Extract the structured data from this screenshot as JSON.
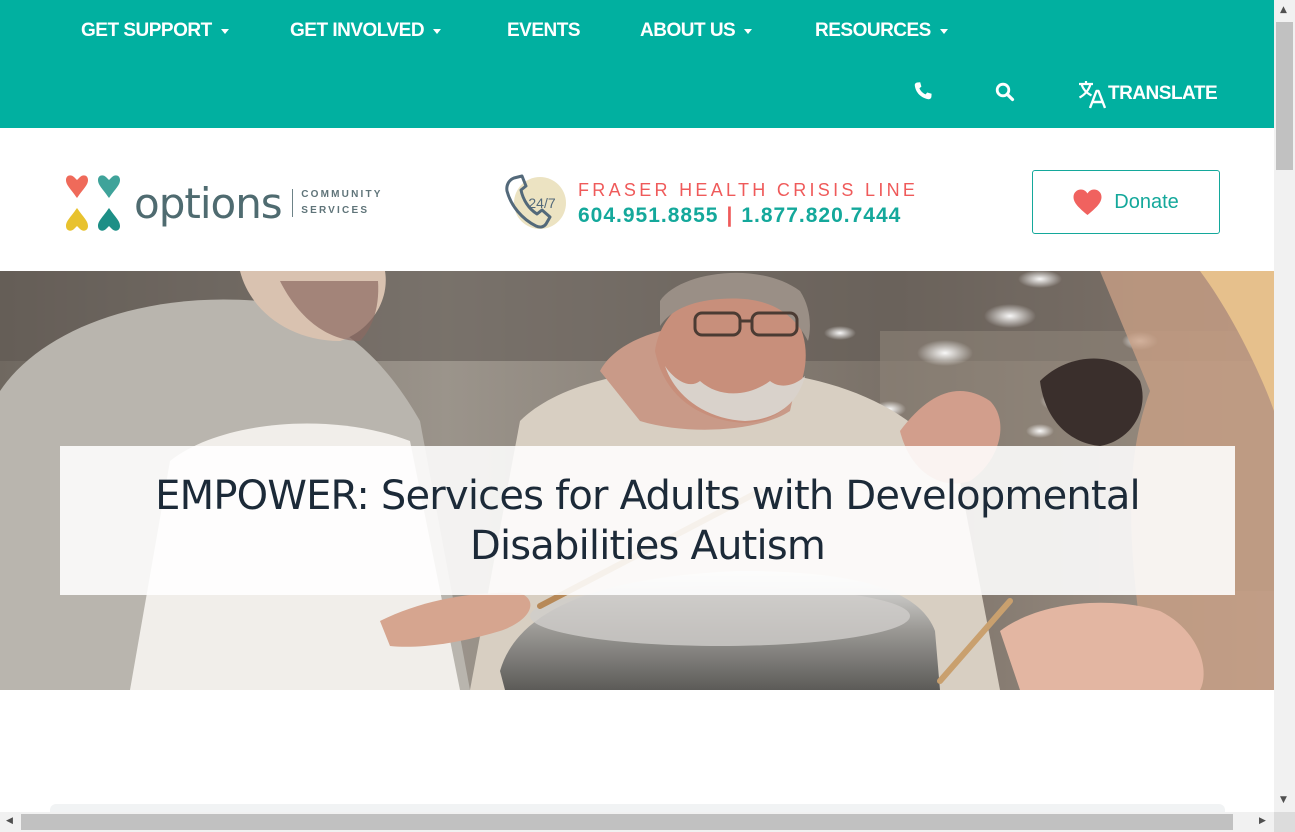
{
  "nav": {
    "items": [
      {
        "label": "GET SUPPORT",
        "dropdown": true
      },
      {
        "label": "GET INVOLVED",
        "dropdown": true
      },
      {
        "label": "EVENTS",
        "dropdown": false
      },
      {
        "label": "ABOUT US",
        "dropdown": true
      },
      {
        "label": "RESOURCES",
        "dropdown": true
      }
    ],
    "phone_icon": "phone-icon",
    "search_icon": "search-icon",
    "translate_icon": "translate-icon",
    "translate_label": "TRANSLATE"
  },
  "logo": {
    "word": "options",
    "sub_line1": "COMMUNITY",
    "sub_line2": "SERVICES"
  },
  "crisis": {
    "badge": "24/7",
    "title": "FRASER HEALTH CRISIS LINE",
    "phone1": "604.951.8855",
    "separator": "|",
    "phone2": "1.877.820.7444"
  },
  "donate": {
    "label": "Donate",
    "icon": "heart-icon"
  },
  "hero": {
    "title": "EMPOWER: Services for Adults with Developmental Disabilities Autism"
  },
  "colors": {
    "brand_teal": "#01b0a0",
    "accent_teal": "#14a89b",
    "accent_red": "#ef5a5a",
    "heading_dark": "#1c2a38"
  }
}
